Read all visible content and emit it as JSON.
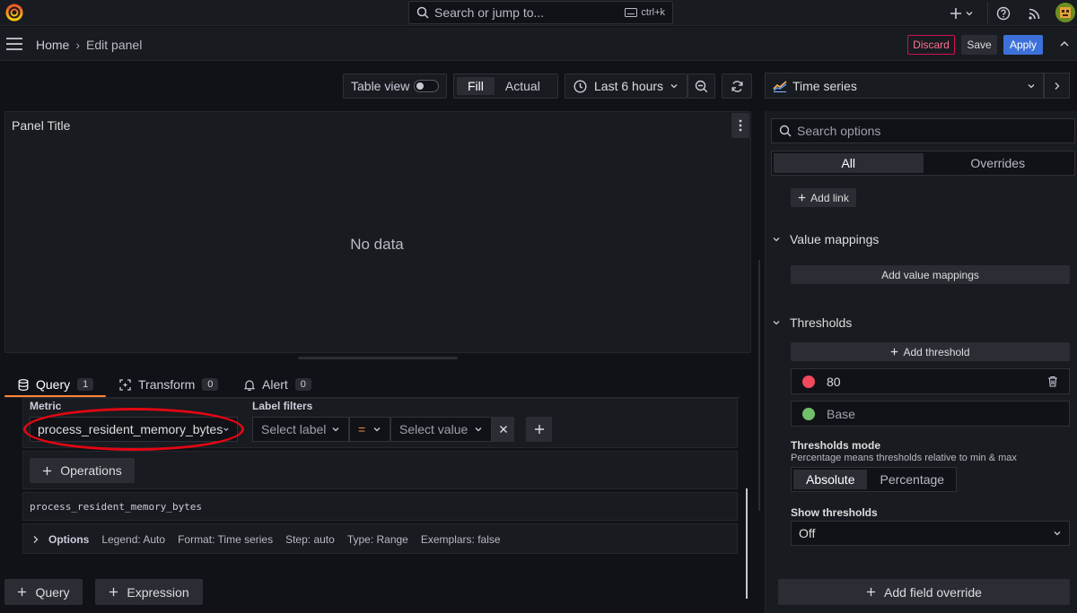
{
  "topbar": {
    "search_placeholder": "Search or jump to...",
    "search_shortcut": "ctrl+k"
  },
  "breadcrumb": {
    "home": "Home",
    "current": "Edit panel"
  },
  "actions": {
    "discard": "Discard",
    "save": "Save",
    "apply": "Apply"
  },
  "toolbar": {
    "table_view": "Table view",
    "table_view_on": false,
    "fill": "Fill",
    "actual": "Actual",
    "fill_selected": "Fill",
    "time_range": "Last 6 hours"
  },
  "panel": {
    "title": "Panel Title",
    "no_data": "No data"
  },
  "query_tabs": [
    {
      "label": "Query",
      "count": "1",
      "active": true
    },
    {
      "label": "Transform",
      "count": "0",
      "active": false
    },
    {
      "label": "Alert",
      "count": "0",
      "active": false
    }
  ],
  "query": {
    "metric_label": "Metric",
    "metric_value": "process_resident_memory_bytes",
    "label_filters_label": "Label filters",
    "select_label": "Select label",
    "operator": "=",
    "select_value": "Select value",
    "operations_button": "Operations",
    "raw_query": "process_resident_memory_bytes",
    "options_label": "Options",
    "options_meta": [
      "Legend: Auto",
      "Format: Time series",
      "Step: auto",
      "Type: Range",
      "Exemplars: false"
    ]
  },
  "bottom_buttons": {
    "add_query": "Query",
    "add_expression": "Expression"
  },
  "options_pane": {
    "visualization": "Time series",
    "search_placeholder": "Search options",
    "tabs": [
      "All",
      "Overrides"
    ],
    "active_tab": "All",
    "add_link": "Add link",
    "value_mappings_title": "Value mappings",
    "add_value_mappings": "Add value mappings",
    "thresholds_title": "Thresholds",
    "add_threshold": "Add threshold",
    "thresholds": [
      {
        "value": "80",
        "color": "#f2495c"
      },
      {
        "value": "Base",
        "color": "#73bf69"
      }
    ],
    "thresholds_mode_label": "Thresholds mode",
    "thresholds_mode_desc": "Percentage means thresholds relative to min & max",
    "thresholds_modes": [
      "Absolute",
      "Percentage"
    ],
    "thresholds_mode_selected": "Absolute",
    "show_thresholds_label": "Show thresholds",
    "show_thresholds_value": "Off",
    "add_field_override": "Add field override"
  },
  "colors": {
    "accent": "#ff8833",
    "primary": "#3d71d9",
    "destructive": "#d10e5c",
    "highlight_ellipse": "#e30613"
  }
}
